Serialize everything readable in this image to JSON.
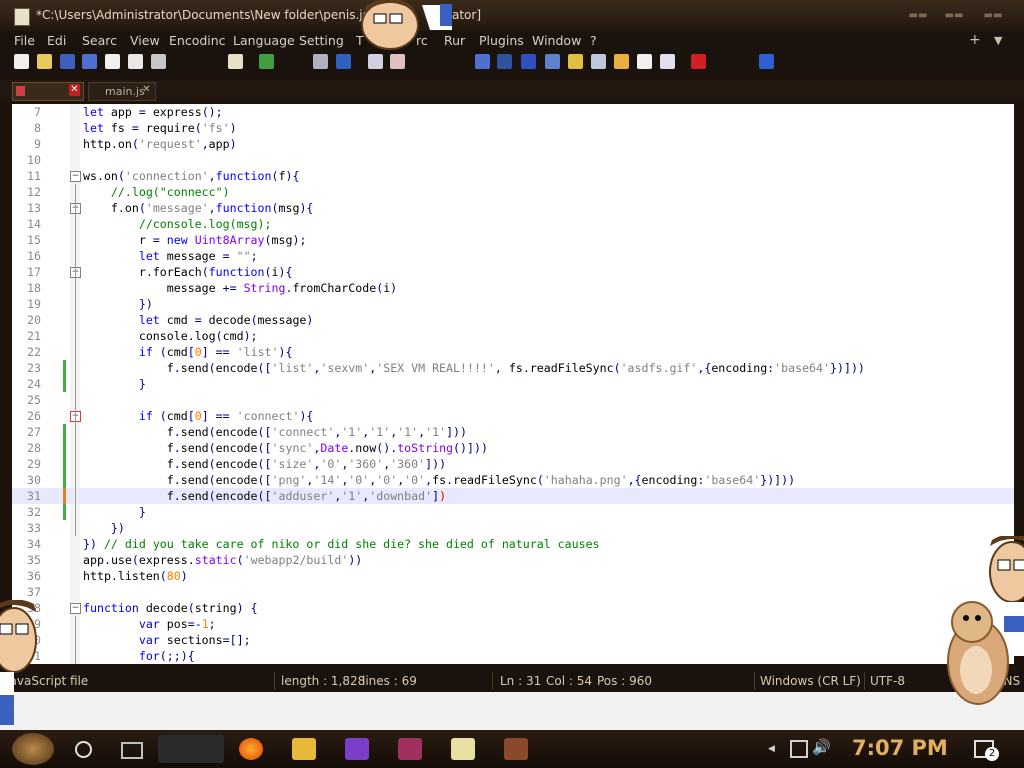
{
  "window": {
    "title": "*C:\\Users\\Administrator\\Documents\\New folder\\penis.js - N",
    "title_suffix": "ator]"
  },
  "menu": {
    "items": [
      "File",
      "Edit",
      "Search",
      "View",
      "Encoding",
      "Language",
      "Settings",
      "T",
      "rc",
      "Run",
      "Plugins",
      "Window",
      "?"
    ],
    "display": [
      "File",
      "Edi",
      "Searc",
      "View",
      "Encodinc",
      "Language",
      "Setting",
      "T",
      "rc",
      "Rur",
      "Plugins",
      "Window",
      "?"
    ],
    "plus": "+",
    "dropdown": "▼",
    "close": "✕"
  },
  "tabs": [
    {
      "label": "",
      "active": true,
      "close": "✕"
    },
    {
      "label": "main.js",
      "active": false,
      "close": "✕"
    }
  ],
  "code_lines": [
    {
      "n": "7",
      "html": "<span class='k'>let</span> app <span class='o'>=</span> express<span class='o'>();</span>"
    },
    {
      "n": "8",
      "html": "<span class='k'>let</span> fs <span class='o'>=</span> require<span class='o'>(</span><span class='s'>'fs'</span><span class='o'>)</span>"
    },
    {
      "n": "9",
      "html": "http<span class='o'>.</span>on<span class='o'>(</span><span class='s'>'request'</span><span class='o'>,</span>app<span class='o'>)</span>"
    },
    {
      "n": "10",
      "html": ""
    },
    {
      "n": "11",
      "html": "ws<span class='o'>.</span>on<span class='o'>(</span><span class='s'>'connection'</span><span class='o'>,</span><span class='k'>function</span><span class='o'>(</span>f<span class='o'>){</span>"
    },
    {
      "n": "12",
      "html": "    <span class='c'>//.log(\"connecc\")</span>"
    },
    {
      "n": "13",
      "html": "    f<span class='o'>.</span>on<span class='o'>(</span><span class='s'>'message'</span><span class='o'>,</span><span class='k'>function</span><span class='o'>(</span>msg<span class='o'>){</span>"
    },
    {
      "n": "14",
      "html": "        <span class='c'>//console.log(msg);</span>"
    },
    {
      "n": "15",
      "html": "        r <span class='o'>=</span> <span class='k'>new</span> <span class='f'>Uint8Array</span><span class='o'>(</span>msg<span class='o'>);</span>"
    },
    {
      "n": "16",
      "html": "        <span class='k'>let</span> message <span class='o'>=</span> <span class='s'>\"\"</span><span class='o'>;</span>"
    },
    {
      "n": "17",
      "html": "        r<span class='o'>.</span>forEach<span class='o'>(</span><span class='k'>function</span><span class='o'>(</span>i<span class='o'>){</span>"
    },
    {
      "n": "18",
      "html": "            message <span class='o'>+=</span> <span class='f'>String</span><span class='o'>.</span>fromCharCode<span class='o'>(</span>i<span class='o'>)</span>"
    },
    {
      "n": "19",
      "html": "        <span class='o'>})</span>"
    },
    {
      "n": "20",
      "html": "        <span class='k'>let</span> cmd <span class='o'>=</span> decode<span class='o'>(</span>message<span class='o'>)</span>"
    },
    {
      "n": "21",
      "html": "        console<span class='o'>.</span>log<span class='o'>(</span>cmd<span class='o'>);</span>"
    },
    {
      "n": "22",
      "html": "        <span class='k'>if</span> <span class='o'>(</span>cmd<span class='o'>[</span><span class='n'>0</span><span class='o'>]</span> <span class='o'>==</span> <span class='s'>'list'</span><span class='o'>){</span>"
    },
    {
      "n": "23",
      "html": "            f<span class='o'>.</span>send<span class='o'>(</span>encode<span class='o'>([</span><span class='s'>'list'</span><span class='o'>,</span><span class='s'>'sexvm'</span><span class='o'>,</span><span class='s'>'SEX VM REAL!!!!'</span><span class='o'>,</span> fs<span class='o'>.</span>readFileSync<span class='o'>(</span><span class='s'>'asdfs.gif'</span><span class='o'>,{</span>encoding<span class='o'>:</span><span class='s'>'base64'</span><span class='o'>})]))</span>"
    },
    {
      "n": "24",
      "html": "        <span class='o'>}</span>"
    },
    {
      "n": "25",
      "html": ""
    },
    {
      "n": "26",
      "html": "        <span class='k'>if</span> <span class='o'>(</span>cmd<span class='o'>[</span><span class='n'>0</span><span class='o'>]</span> <span class='o'>==</span> <span class='s'>'connect'</span><span class='o'>){</span>"
    },
    {
      "n": "27",
      "html": "            f<span class='o'>.</span>send<span class='o'>(</span>encode<span class='o'>([</span><span class='s'>'connect'</span><span class='o'>,</span><span class='s'>'1'</span><span class='o'>,</span><span class='s'>'1'</span><span class='o'>,</span><span class='s'>'1'</span><span class='o'>,</span><span class='s'>'1'</span><span class='o'>]))</span>"
    },
    {
      "n": "28",
      "html": "            f<span class='o'>.</span>send<span class='o'>(</span>encode<span class='o'>([</span><span class='s'>'sync'</span><span class='o'>,</span><span class='f'>Date</span><span class='o'>.</span>now<span class='o'>().</span><span class='f'>toString</span><span class='o'>()]))</span>"
    },
    {
      "n": "29",
      "html": "            f<span class='o'>.</span>send<span class='o'>(</span>encode<span class='o'>([</span><span class='s'>'size'</span><span class='o'>,</span><span class='s'>'0'</span><span class='o'>,</span><span class='s'>'360'</span><span class='o'>,</span><span class='s'>'360'</span><span class='o'>]))</span>"
    },
    {
      "n": "30",
      "html": "            f<span class='o'>.</span>send<span class='o'>(</span>encode<span class='o'>([</span><span class='s'>'png'</span><span class='o'>,</span><span class='s'>'14'</span><span class='o'>,</span><span class='s'>'0'</span><span class='o'>,</span><span class='s'>'0'</span><span class='o'>,</span><span class='s'>'0'</span><span class='o'>,</span>fs<span class='o'>.</span>readFileSync<span class='o'>(</span><span class='s'>'hahaha.png'</span><span class='o'>,{</span>encoding<span class='o'>:</span><span class='s'>'base64'</span><span class='o'>})]))</span>"
    },
    {
      "n": "31",
      "html": "            f<span class='o'>.</span>send<span class='o'>(</span>encode<span class='o'>([</span><span class='s'>'adduser'</span><span class='o'>,</span><span class='s'>'1'</span><span class='o'>,</span><span class='s'>'downbad'</span><span class='o'>]</span><span style='color:#d00'>)</span>"
    },
    {
      "n": "32",
      "html": "        <span class='o'>}</span>"
    },
    {
      "n": "33",
      "html": "    <span class='o'>})</span>"
    },
    {
      "n": "34",
      "html": "<span class='o'>})</span> <span class='c'>// did you take care of niko or did she die? she died of natural causes</span>"
    },
    {
      "n": "35",
      "html": "app<span class='o'>.</span>use<span class='o'>(</span>express<span class='o'>.</span><span class='f'>static</span><span class='o'>(</span><span class='s'>'webapp2/build'</span><span class='o'>))</span>"
    },
    {
      "n": "36",
      "html": "http<span class='o'>.</span>listen<span class='o'>(</span><span class='n'>80</span><span class='o'>)</span>"
    },
    {
      "n": "37",
      "html": ""
    },
    {
      "n": "38",
      "html": "<span class='k'>function</span> decode<span class='o'>(</span>string<span class='o'>)</span> <span class='o'>{</span>"
    },
    {
      "n": "39",
      "html": "        <span class='k'>var</span> pos<span class='o'>=-</span><span class='n'>1</span><span class='o'>;</span>"
    },
    {
      "n": "40",
      "html": "        <span class='k'>var</span> sections<span class='o'>=[];</span>"
    },
    {
      "n": "41",
      "html": "        <span class='k'>for</span><span class='o'>(;;){</span>"
    }
  ],
  "status": {
    "filetype": "JavaScript file",
    "length": "length : 1,828",
    "lines": "lines : 69",
    "ln": "Ln : 31",
    "col": "Col : 54",
    "pos": "Pos : 960",
    "eol": "Windows (CR LF)",
    "encoding": "UTF-8",
    "mode": "INS"
  },
  "taskbar": {
    "clock": "7:07 PM",
    "notifications": "2"
  }
}
